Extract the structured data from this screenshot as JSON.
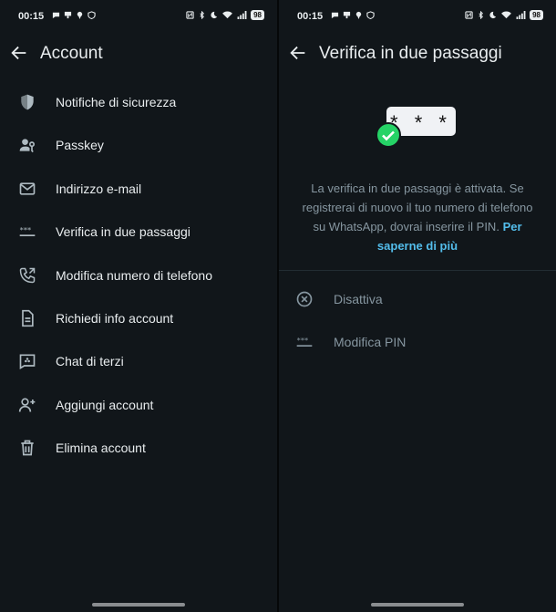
{
  "status_bar": {
    "time": "00:15",
    "battery": "98"
  },
  "left": {
    "title": "Account",
    "items": [
      {
        "label": "Notifiche di sicurezza",
        "icon": "shield-icon"
      },
      {
        "label": "Passkey",
        "icon": "passkey-icon"
      },
      {
        "label": "Indirizzo e-mail",
        "icon": "mail-icon"
      },
      {
        "label": "Verifica in due passaggi",
        "icon": "pin-dots-icon"
      },
      {
        "label": "Modifica numero di telefono",
        "icon": "phone-change-icon"
      },
      {
        "label": "Richiedi info account",
        "icon": "document-icon"
      },
      {
        "label": "Chat di terzi",
        "icon": "third-party-chat-icon"
      },
      {
        "label": "Aggiungi account",
        "icon": "add-account-icon"
      },
      {
        "label": "Elimina account",
        "icon": "trash-icon"
      }
    ]
  },
  "right": {
    "title": "Verifica in due passaggi",
    "hero_text": "* * *",
    "description": "La verifica in due passaggi è attivata. Se registrerai di nuovo il tuo numero di telefono su WhatsApp, dovrai inserire il PIN.",
    "learn_more": "Per saperne di più",
    "options": [
      {
        "label": "Disattiva",
        "icon": "disable-circle-x-icon"
      },
      {
        "label": "Modifica PIN",
        "icon": "pin-dots-icon"
      }
    ]
  },
  "colors": {
    "background": "#11161a",
    "text": "#e9edef",
    "muted": "#8696a0",
    "link": "#53bdeb",
    "accent": "#25d366"
  }
}
